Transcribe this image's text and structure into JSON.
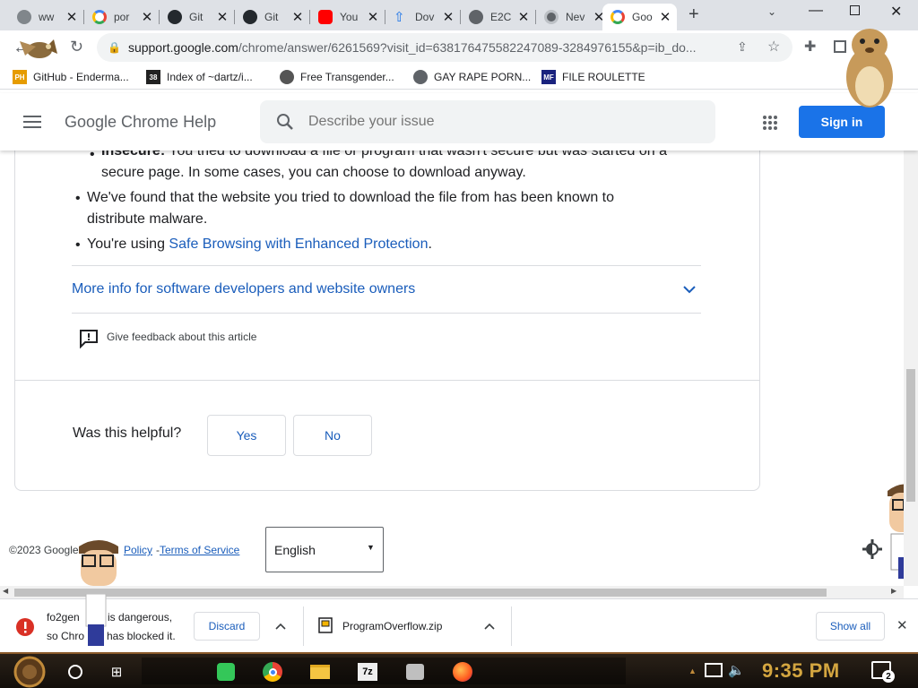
{
  "tabs": [
    {
      "title": "ww",
      "icon": "globe-icon"
    },
    {
      "title": "por",
      "icon": "google-g-icon"
    },
    {
      "title": "Git",
      "icon": "github-icon"
    },
    {
      "title": "Git",
      "icon": "github-icon"
    },
    {
      "title": "You",
      "icon": "youtube-icon"
    },
    {
      "title": "Dov",
      "icon": "download-arrow-icon"
    },
    {
      "title": "E2C",
      "icon": "globe-icon"
    },
    {
      "title": "Nev",
      "icon": "chrome-icon"
    },
    {
      "title": "Goo",
      "icon": "google-g-icon",
      "active": true
    }
  ],
  "omnibox": {
    "url_main": "support.google.com",
    "url_rest": "/chrome/answer/6261569?visit_id=638176475582247089-3284976155&p=ib_do..."
  },
  "bookmarks": [
    {
      "label": "GitHub - Enderma...",
      "icon_text": "PH"
    },
    {
      "label": "Index of ~dartz/i...",
      "icon_text": "38"
    },
    {
      "label": "Free Transgender...",
      "icon_text": ""
    },
    {
      "label": "GAY RAPE PORN...",
      "icon_text": ""
    },
    {
      "label": "FILE ROULETTE",
      "icon_text": "MF"
    }
  ],
  "header": {
    "title": "Google Chrome Help",
    "search_placeholder": "Describe your issue",
    "signin_label": "Sign in"
  },
  "article": {
    "insecure_label": "Insecure:",
    "insecure_text_line1": " You tried to download a file or program that wasn't secure but was started on a",
    "insecure_text_line2": "secure page. In some cases, you can choose to download anyway.",
    "malware_line1": "We've found that the website you tried to download the file from has been known to",
    "malware_line2": "distribute malware.",
    "safe_prefix": "You're using ",
    "safe_link": "Safe Browsing with Enhanced Protection",
    "safe_suffix": ".",
    "more_info": "More info for software developers and website owners",
    "feedback": "Give feedback about this article",
    "helpful_q": "Was this helpful?",
    "yes": "Yes",
    "no": "No"
  },
  "footer": {
    "copyright": "©2023 Google",
    "privacy": "Policy",
    "terms": "Terms of Service",
    "language": "English"
  },
  "downloads": {
    "blocked_line1": "fo2gen",
    "blocked_line1b": "is dangerous,",
    "blocked_line2": "so Chro",
    "blocked_line2b": "has blocked it.",
    "discard": "Discard",
    "file2": "ProgramOverflow.zip",
    "show_all": "Show all"
  },
  "taskbar": {
    "time": "9:35 PM",
    "notification_count": "2"
  },
  "colors": {
    "link": "#1a5dbb",
    "signin_bg": "#1a73e8",
    "danger": "#d93025"
  }
}
